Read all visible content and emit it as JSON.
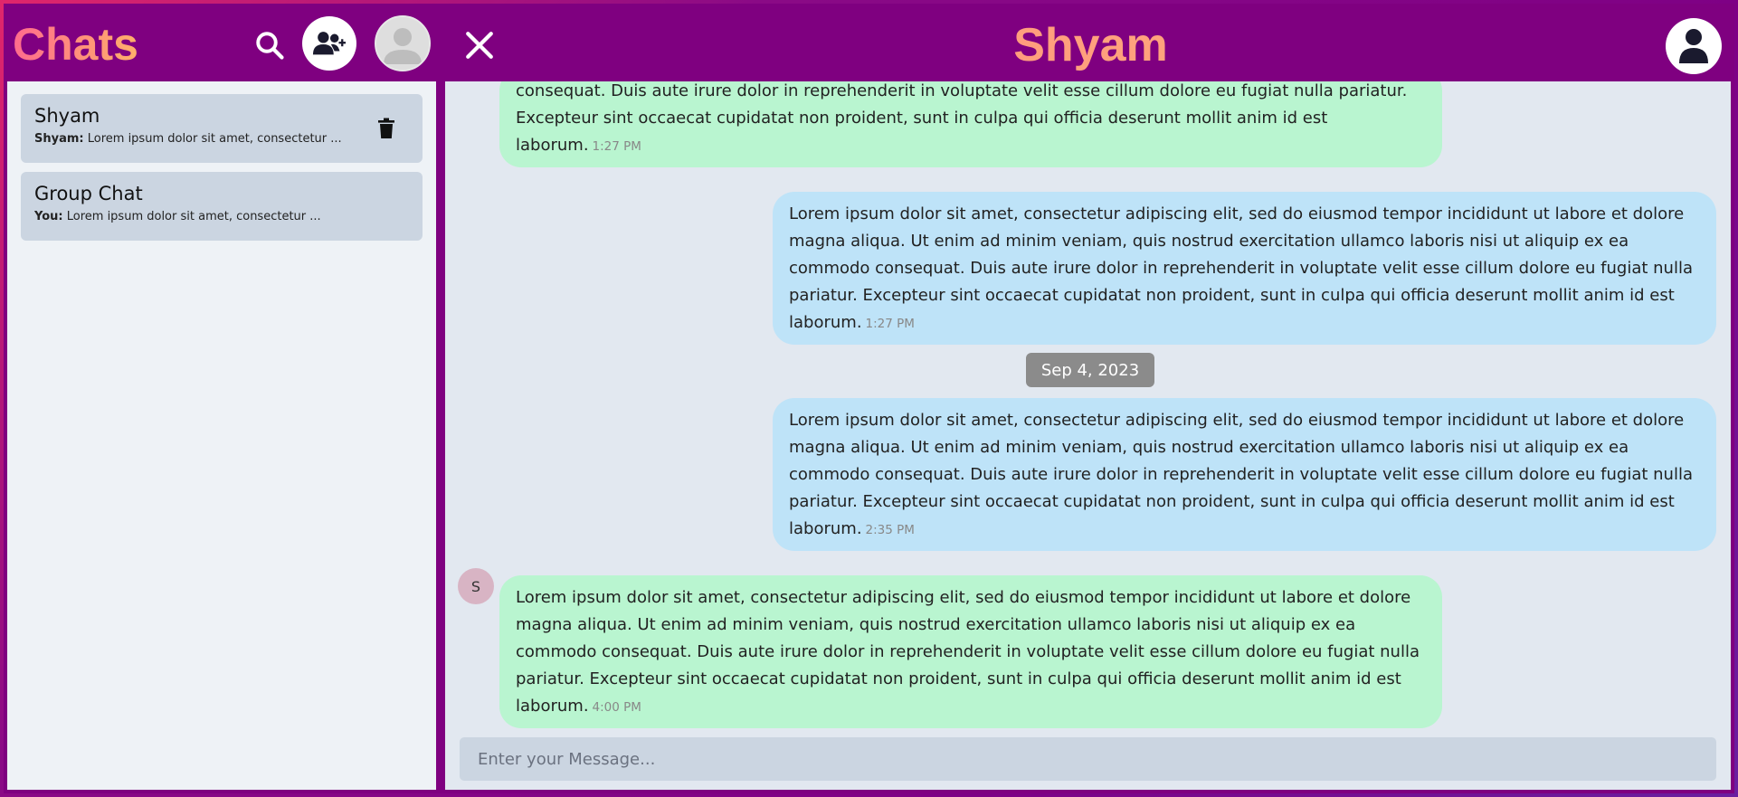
{
  "header": {
    "chats_title": "Chats",
    "chat_title": "Shyam"
  },
  "sidebar": {
    "items": [
      {
        "name": "Shyam",
        "sender": "Shyam:",
        "preview": "Lorem ipsum dolor sit amet, consectetur ..."
      },
      {
        "name": "Group Chat",
        "sender": "You:",
        "preview": "Lorem ipsum dolor sit amet, consectetur ..."
      }
    ]
  },
  "messages": [
    {
      "side": "received",
      "text": "consequat. Duis aute irure dolor in reprehenderit in voluptate velit esse cillum dolore eu fugiat nulla pariatur. Excepteur sint occaecat cupidatat non proident, sunt in culpa qui officia deserunt mollit anim id est laborum.",
      "time": "1:27 PM"
    },
    {
      "side": "sent",
      "text": "Lorem ipsum dolor sit amet, consectetur adipiscing elit, sed do eiusmod tempor incididunt ut labore et dolore magna aliqua. Ut enim ad minim veniam, quis nostrud exercitation ullamco laboris nisi ut aliquip ex ea commodo consequat. Duis aute irure dolor in reprehenderit in voluptate velit esse cillum dolore eu fugiat nulla pariatur. Excepteur sint occaecat cupidatat non proident, sunt in culpa qui officia deserunt mollit anim id est laborum.",
      "time": "1:27 PM"
    },
    {
      "side": "sent",
      "text": "Lorem ipsum dolor sit amet, consectetur adipiscing elit, sed do eiusmod tempor incididunt ut labore et dolore magna aliqua. Ut enim ad minim veniam, quis nostrud exercitation ullamco laboris nisi ut aliquip ex ea commodo consequat. Duis aute irure dolor in reprehenderit in voluptate velit esse cillum dolore eu fugiat nulla pariatur. Excepteur sint occaecat cupidatat non proident, sunt in culpa qui officia deserunt mollit anim id est laborum.",
      "time": "2:35 PM"
    },
    {
      "side": "received",
      "text": "Lorem ipsum dolor sit amet, consectetur adipiscing elit, sed do eiusmod tempor incididunt ut labore et dolore magna aliqua. Ut enim ad minim veniam, quis nostrud exercitation ullamco laboris nisi ut aliquip ex ea commodo consequat. Duis aute irure dolor in reprehenderit in voluptate velit esse cillum dolore eu fugiat nulla pariatur. Excepteur sint occaecat cupidatat non proident, sunt in culpa qui officia deserunt mollit anim id est laborum.",
      "time": "4:00 PM"
    }
  ],
  "date_separator": "Sep 4, 2023",
  "sender_initial": "S",
  "composer": {
    "placeholder": "Enter your Message..."
  },
  "icons": {
    "search": "search-icon",
    "add_user": "user-plus-icon",
    "profile": "avatar-icon",
    "close": "close-icon",
    "contact": "user-icon",
    "delete": "trash-icon"
  }
}
